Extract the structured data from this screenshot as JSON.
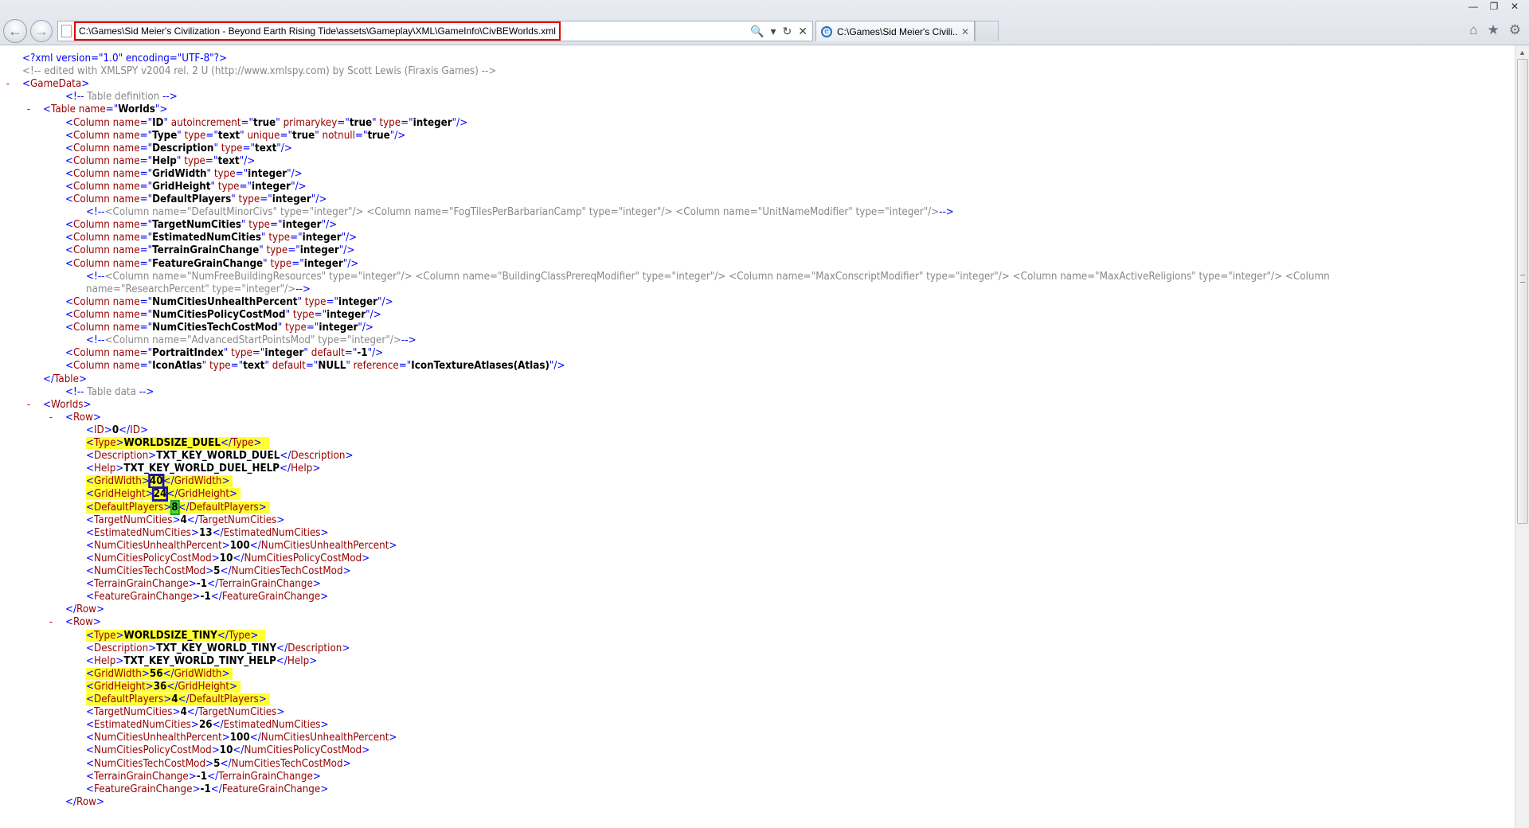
{
  "browser": {
    "address": "C:\\Games\\Sid Meier's Civilization - Beyond Earth Rising Tide\\assets\\Gameplay\\XML\\GameInfo\\CivBEWorlds.xml",
    "tab_title": "C:\\Games\\Sid Meier's Civili...",
    "tab_close": "✕",
    "back_icon": "back-arrow-icon",
    "forward_icon": "forward-arrow-icon",
    "search_icon": "🔍",
    "dropdown_icon": "▾",
    "refresh_icon": "↻",
    "stop_icon": "✕",
    "home_icon": "⌂",
    "favorites_icon": "★",
    "tools_icon": "⚙",
    "minimize": "—",
    "maximize": "❐",
    "close": "✕"
  },
  "xml": {
    "declaration": "<?xml version=\"1.0\" encoding=\"UTF-8\"?>",
    "header_comment": "<!-- edited with XMLSPY v2004 rel. 2 U (http://www.xmlspy.com) by Scott Lewis (Firaxis Games) -->",
    "table_def_comment": "Table definition",
    "table_data_comment": "Table data",
    "table_name": "Worlds",
    "columns": [
      {
        "name": "ID",
        "attrs": [
          [
            "autoincrement",
            "true"
          ],
          [
            "primarykey",
            "true"
          ],
          [
            "type",
            "integer"
          ]
        ]
      },
      {
        "name": "Type",
        "attrs": [
          [
            "type",
            "text"
          ],
          [
            "unique",
            "true"
          ],
          [
            "notnull",
            "true"
          ]
        ]
      },
      {
        "name": "Description",
        "attrs": [
          [
            "type",
            "text"
          ]
        ]
      },
      {
        "name": "Help",
        "attrs": [
          [
            "type",
            "text"
          ]
        ]
      },
      {
        "name": "GridWidth",
        "attrs": [
          [
            "type",
            "integer"
          ]
        ]
      },
      {
        "name": "GridHeight",
        "attrs": [
          [
            "type",
            "integer"
          ]
        ]
      },
      {
        "name": "DefaultPlayers",
        "attrs": [
          [
            "type",
            "integer"
          ]
        ]
      }
    ],
    "comment_cols_1": "<Column name=\"DefaultMinorCivs\" type=\"integer\"/> <Column name=\"FogTilesPerBarbarianCamp\" type=\"integer\"/> <Column name=\"UnitNameModifier\" type=\"integer\"/>",
    "columns2": [
      {
        "name": "TargetNumCities",
        "attrs": [
          [
            "type",
            "integer"
          ]
        ]
      },
      {
        "name": "EstimatedNumCities",
        "attrs": [
          [
            "type",
            "integer"
          ]
        ]
      },
      {
        "name": "TerrainGrainChange",
        "attrs": [
          [
            "type",
            "integer"
          ]
        ]
      },
      {
        "name": "FeatureGrainChange",
        "attrs": [
          [
            "type",
            "integer"
          ]
        ]
      }
    ],
    "comment_cols_2a": "<Column name=\"NumFreeBuildingResources\" type=\"integer\"/> <Column name=\"BuildingClassPrereqModifier\" type=\"integer\"/> <Column name=\"MaxConscriptModifier\" type=\"integer\"/> <Column name=\"MaxActiveReligions\" type=\"integer\"/> <Column",
    "comment_cols_2b": "name=\"ResearchPercent\" type=\"integer\"/>",
    "columns3": [
      {
        "name": "NumCitiesUnhealthPercent",
        "attrs": [
          [
            "type",
            "integer"
          ]
        ]
      },
      {
        "name": "NumCitiesPolicyCostMod",
        "attrs": [
          [
            "type",
            "integer"
          ]
        ]
      },
      {
        "name": "NumCitiesTechCostMod",
        "attrs": [
          [
            "type",
            "integer"
          ]
        ]
      }
    ],
    "comment_cols_3": "<Column name=\"AdvancedStartPointsMod\" type=\"integer\"/>",
    "columns4": [
      {
        "name": "PortraitIndex",
        "attrs": [
          [
            "type",
            "integer"
          ],
          [
            "default",
            "-1"
          ]
        ]
      },
      {
        "name": "IconAtlas",
        "attrs": [
          [
            "type",
            "text"
          ],
          [
            "default",
            "NULL"
          ],
          [
            "reference",
            "IconTextureAtlases(Atlas)"
          ]
        ]
      }
    ],
    "rows": [
      {
        "fields": [
          [
            "ID",
            "0"
          ],
          [
            "Type",
            "WORLDSIZE_DUEL"
          ],
          [
            "Description",
            "TXT_KEY_WORLD_DUEL"
          ],
          [
            "Help",
            "TXT_KEY_WORLD_DUEL_HELP"
          ],
          [
            "GridWidth",
            "40"
          ],
          [
            "GridHeight",
            "24"
          ],
          [
            "DefaultPlayers",
            "8"
          ],
          [
            "TargetNumCities",
            "4"
          ],
          [
            "EstimatedNumCities",
            "13"
          ],
          [
            "NumCitiesUnhealthPercent",
            "100"
          ],
          [
            "NumCitiesPolicyCostMod",
            "10"
          ],
          [
            "NumCitiesTechCostMod",
            "5"
          ],
          [
            "TerrainGrainChange",
            "-1"
          ],
          [
            "FeatureGrainChange",
            "-1"
          ]
        ]
      },
      {
        "fields": [
          [
            "Type",
            "WORLDSIZE_TINY"
          ],
          [
            "Description",
            "TXT_KEY_WORLD_TINY"
          ],
          [
            "Help",
            "TXT_KEY_WORLD_TINY_HELP"
          ],
          [
            "GridWidth",
            "56"
          ],
          [
            "GridHeight",
            "36"
          ],
          [
            "DefaultPlayers",
            "4"
          ],
          [
            "TargetNumCities",
            "4"
          ],
          [
            "EstimatedNumCities",
            "26"
          ],
          [
            "NumCitiesUnhealthPercent",
            "100"
          ],
          [
            "NumCitiesPolicyCostMod",
            "10"
          ],
          [
            "NumCitiesTechCostMod",
            "5"
          ],
          [
            "TerrainGrainChange",
            "-1"
          ],
          [
            "FeatureGrainChange",
            "-1"
          ]
        ]
      }
    ]
  }
}
